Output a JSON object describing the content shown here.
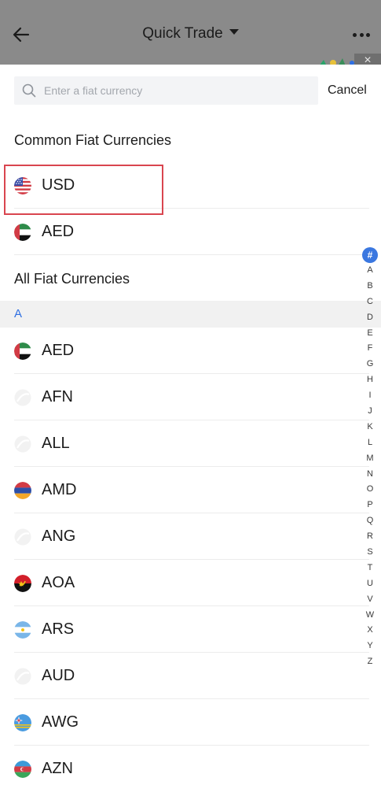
{
  "header": {
    "title": "Quick Trade",
    "close_glyph": "×"
  },
  "search": {
    "placeholder": "Enter a fiat currency",
    "value": "",
    "cancel_label": "Cancel"
  },
  "common": {
    "title": "Common Fiat Currencies",
    "items": [
      {
        "code": "USD",
        "flag": "us-flag-icon"
      },
      {
        "code": "AED",
        "flag": "uae-flag-icon"
      }
    ]
  },
  "all": {
    "title": "All Fiat Currencies",
    "active_letter": "A",
    "items": [
      {
        "code": "AED",
        "flag": "uae-flag-icon"
      },
      {
        "code": "AFN",
        "flag": "placeholder-flag-icon"
      },
      {
        "code": "ALL",
        "flag": "placeholder-flag-icon"
      },
      {
        "code": "AMD",
        "flag": "armenia-flag-icon"
      },
      {
        "code": "ANG",
        "flag": "placeholder-flag-icon"
      },
      {
        "code": "AOA",
        "flag": "angola-flag-icon"
      },
      {
        "code": "ARS",
        "flag": "argentina-flag-icon"
      },
      {
        "code": "AUD",
        "flag": "placeholder-flag-icon"
      },
      {
        "code": "AWG",
        "flag": "aruba-flag-icon"
      },
      {
        "code": "AZN",
        "flag": "azerbaijan-flag-icon"
      }
    ]
  },
  "index": {
    "active": "#",
    "letters": [
      "A",
      "B",
      "C",
      "D",
      "E",
      "F",
      "G",
      "H",
      "I",
      "J",
      "K",
      "L",
      "M",
      "N",
      "O",
      "P",
      "Q",
      "R",
      "S",
      "T",
      "U",
      "V",
      "W",
      "X",
      "Y",
      "Z"
    ]
  },
  "colors": {
    "accent": "#2f6fe2",
    "highlight": "#d9454f",
    "overlay": "#8a8a8a"
  }
}
